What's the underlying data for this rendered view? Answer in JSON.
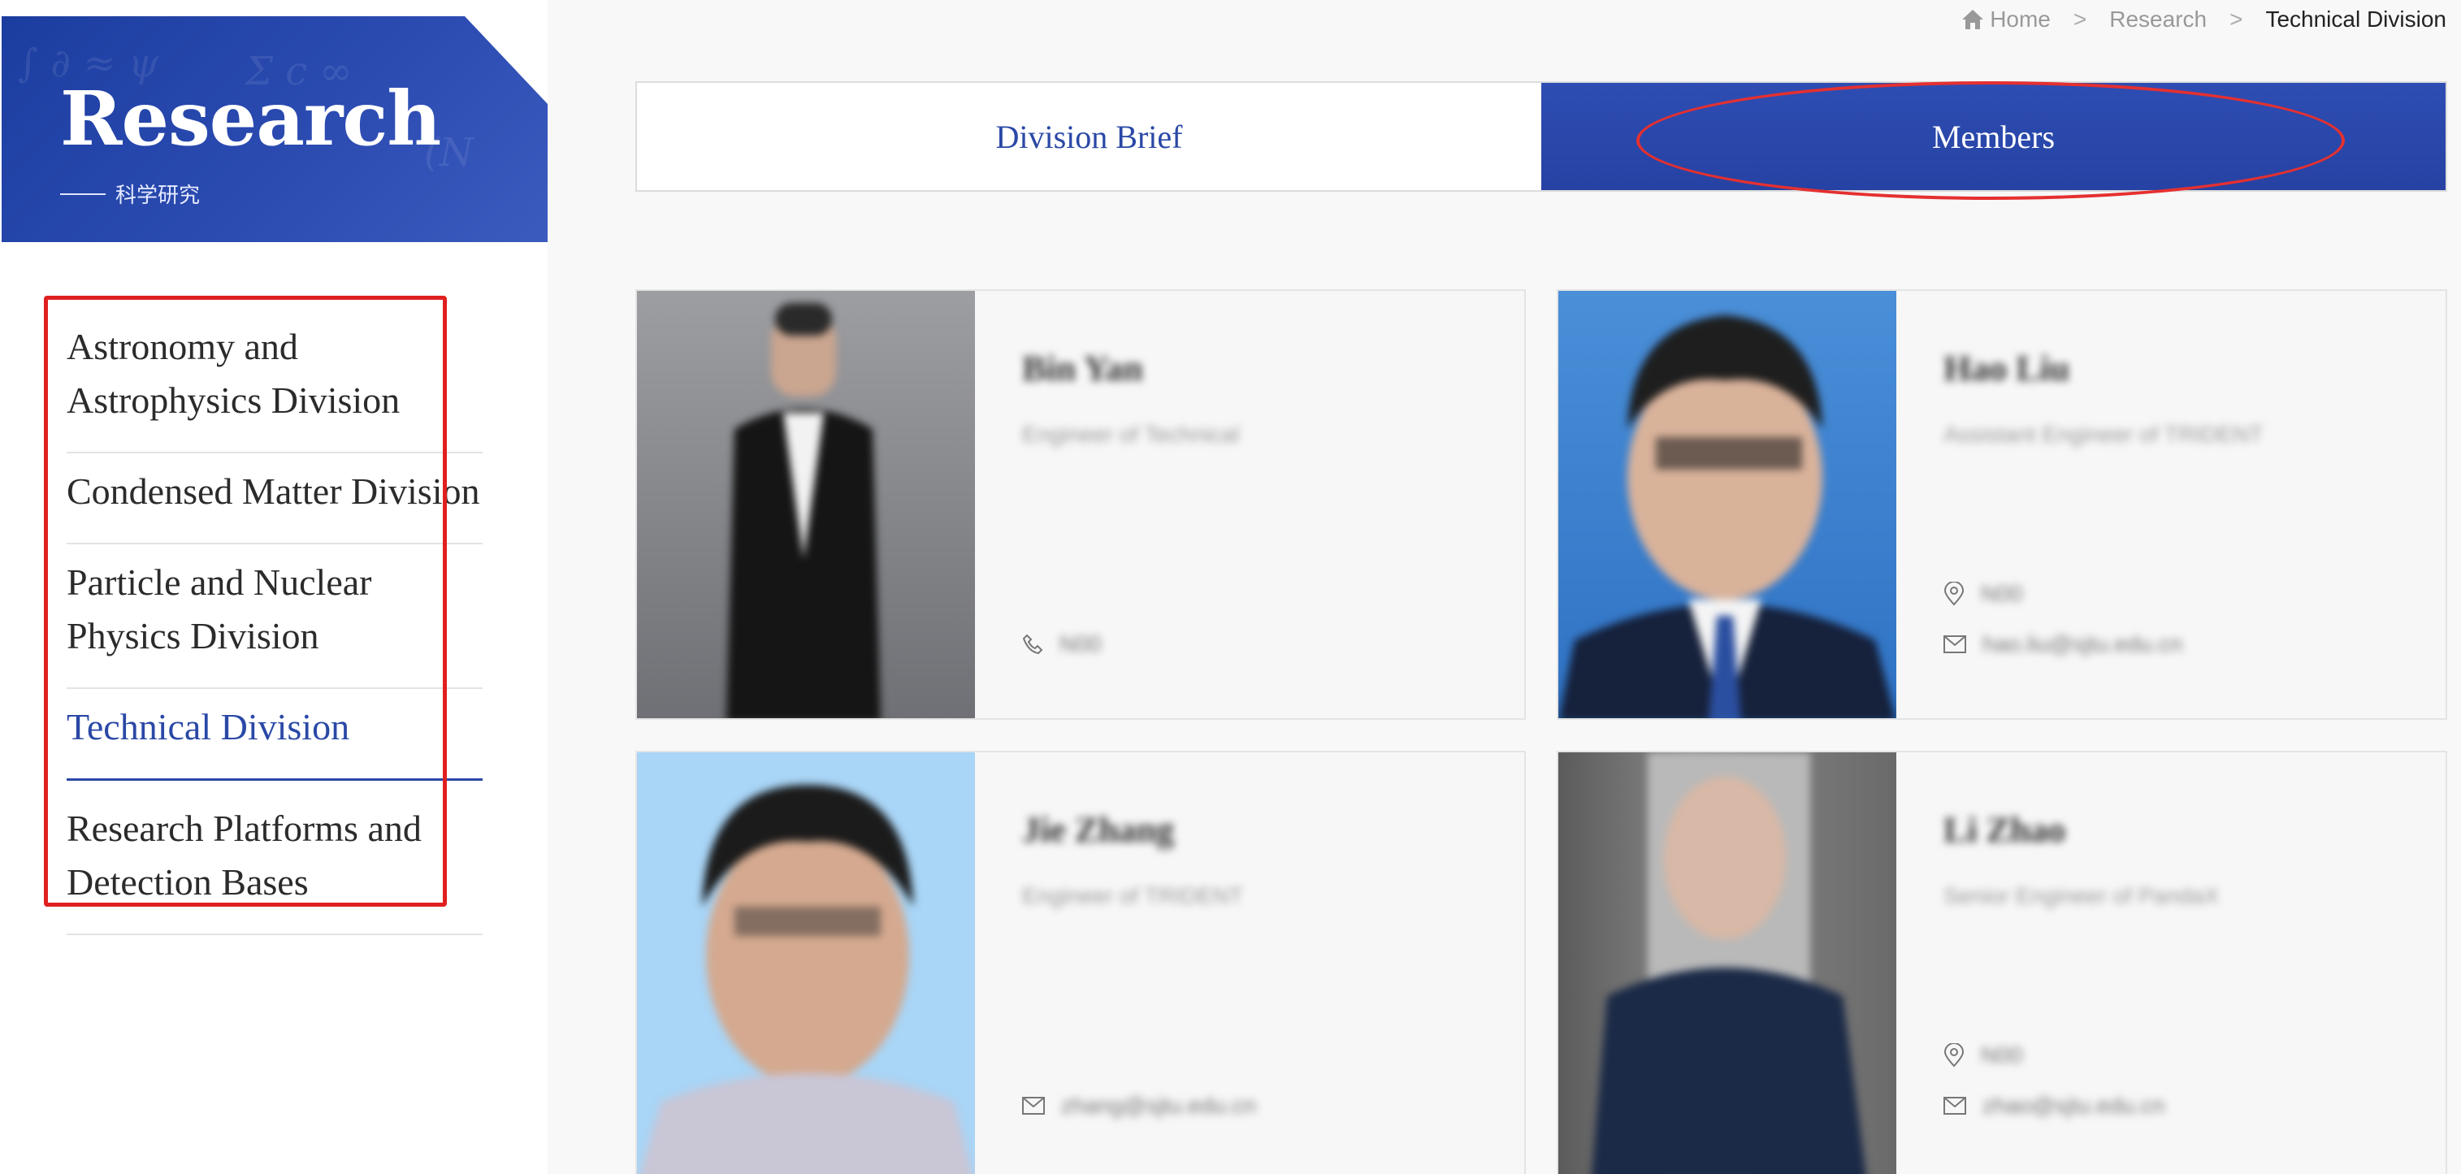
{
  "breadcrumb": {
    "home": "Home",
    "sep": ">",
    "research": "Research",
    "current": "Technical Division"
  },
  "banner": {
    "title": "Research",
    "subtitle": "科学研究"
  },
  "nav": {
    "items": [
      {
        "label": "Astronomy and Astrophysics Division"
      },
      {
        "label": "Condensed Matter Division"
      },
      {
        "label": "Particle and Nuclear Physics Division"
      },
      {
        "label": "Technical Division"
      },
      {
        "label": "Research Platforms and Detection Bases"
      }
    ]
  },
  "tabs": {
    "brief": "Division Brief",
    "members": "Members"
  },
  "members": [
    {
      "name": "Bin Yan",
      "title": "Engineer of Technical",
      "office": "N00",
      "email": ""
    },
    {
      "name": "Hao Liu",
      "title": "Assistant Engineer of TRIDENT",
      "office": "N00",
      "email": "hao.liu@sjtu.edu.cn"
    },
    {
      "name": "Jie Zhang",
      "title": "Engineer of TRIDENT",
      "office": "",
      "email": "zhang@sjtu.edu.cn"
    },
    {
      "name": "Li Zhao",
      "title": "Senior Engineer of PandaX",
      "office": "N00",
      "email": "zhao@sjtu.edu.cn"
    }
  ],
  "colors": {
    "accent": "#2a48a6",
    "highlight": "#e02020"
  }
}
